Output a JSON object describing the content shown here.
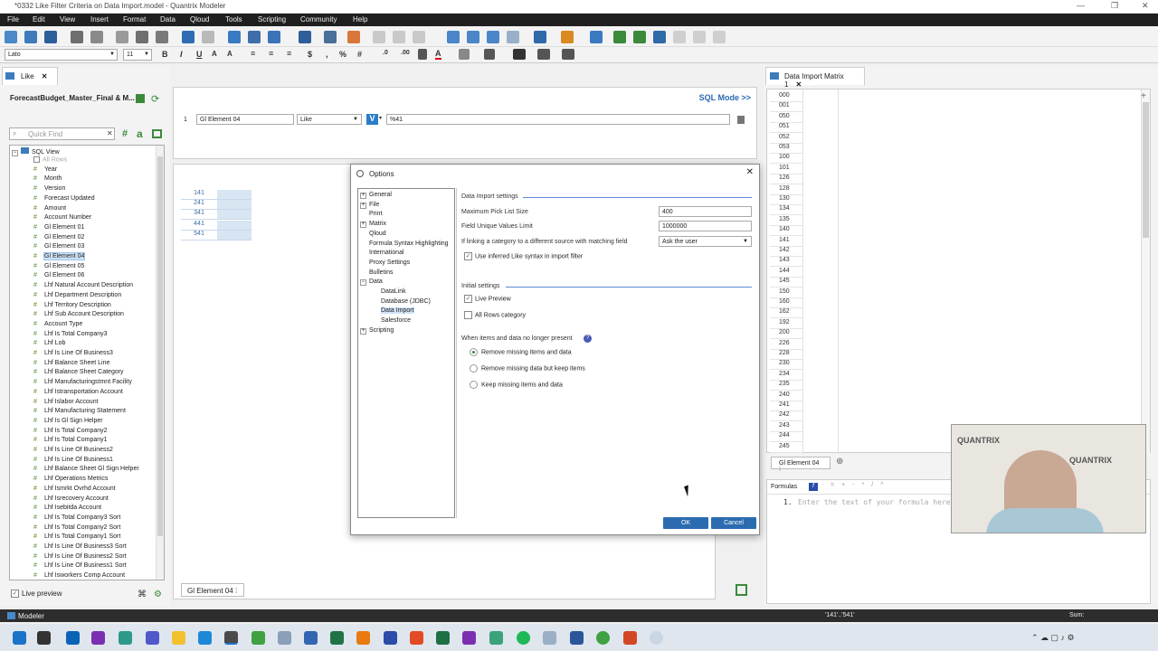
{
  "window": {
    "title": "*0332 Like Filter Criteria on Data Import.model - Quantrix Modeler"
  },
  "menu": [
    "File",
    "Edit",
    "View",
    "Insert",
    "Format",
    "Data",
    "Qloud",
    "Tools",
    "Scripting",
    "Community",
    "Help"
  ],
  "format_bar": {
    "font": "Lato",
    "size": "11"
  },
  "left_tab": {
    "label": "Like",
    "close": "✕"
  },
  "model_name": "ForecastBudget_Master_Final & M...",
  "quick_find": {
    "placeholder": "Quick Find"
  },
  "tree_root": "SQL View",
  "tree_items": [
    {
      "label": "All Rows",
      "kind": "chk"
    },
    {
      "label": "Year",
      "kind": "#"
    },
    {
      "label": "Month",
      "kind": "#"
    },
    {
      "label": "Version",
      "kind": "#"
    },
    {
      "label": "Forecast Updated",
      "kind": "#"
    },
    {
      "label": "Amount",
      "kind": "#"
    },
    {
      "label": "Account Number",
      "kind": "#"
    },
    {
      "label": "Gl Element 01",
      "kind": "#"
    },
    {
      "label": "Gl Element 02",
      "kind": "#"
    },
    {
      "label": "Gl Element 03",
      "kind": "#"
    },
    {
      "label": "Gl Element 04",
      "kind": "#",
      "selected": true
    },
    {
      "label": "Gl Element 05",
      "kind": "#"
    },
    {
      "label": "Gl Element 06",
      "kind": "#"
    },
    {
      "label": "Lhf Natural Account Description",
      "kind": "#"
    },
    {
      "label": "Lhf Department Description",
      "kind": "#"
    },
    {
      "label": "Lhf Territory Description",
      "kind": "#"
    },
    {
      "label": "Lhf Sub Account Description",
      "kind": "#"
    },
    {
      "label": "Account Type",
      "kind": "#"
    },
    {
      "label": "Lhf Is Total Company3",
      "kind": "#"
    },
    {
      "label": "Lhf Lob",
      "kind": "#"
    },
    {
      "label": "Lhf Is Line Of Business3",
      "kind": "#"
    },
    {
      "label": "Lhf Balance Sheet Line",
      "kind": "#"
    },
    {
      "label": "Lhf Balance Sheet Category",
      "kind": "#"
    },
    {
      "label": "Lhf Manufacturingstmnt Facility",
      "kind": "#"
    },
    {
      "label": "Lhf Istransportation Account",
      "kind": "#"
    },
    {
      "label": "Lhf Islabor Account",
      "kind": "#"
    },
    {
      "label": "Lhf Manufacturing Statement",
      "kind": "#"
    },
    {
      "label": "Lhf Is Gl Sign Helper",
      "kind": "#"
    },
    {
      "label": "Lhf Is Total Company2",
      "kind": "#"
    },
    {
      "label": "Lhf Is Total Company1",
      "kind": "#"
    },
    {
      "label": "Lhf Is Line Of Business2",
      "kind": "#"
    },
    {
      "label": "Lhf Is Line Of Business1",
      "kind": "#"
    },
    {
      "label": "Lhf Balance Sheet Gl Sign Helper",
      "kind": "#"
    },
    {
      "label": "Lhf Operations Metrics",
      "kind": "#"
    },
    {
      "label": "Lhf Ismrkt Ovrhd Account",
      "kind": "#"
    },
    {
      "label": "Lhf Isrecovery Account",
      "kind": "#"
    },
    {
      "label": "Lhf Isebitda Account",
      "kind": "#"
    },
    {
      "label": "Lhf Is Total Company3 Sort",
      "kind": "#"
    },
    {
      "label": "Lhf Is Total Company2 Sort",
      "kind": "#"
    },
    {
      "label": "Lhf Is Total Company1 Sort",
      "kind": "#"
    },
    {
      "label": "Lhf Is Line Of Business3 Sort",
      "kind": "#"
    },
    {
      "label": "Lhf Is Line Of Business2 Sort",
      "kind": "#"
    },
    {
      "label": "Lhf Is Line Of Business1 Sort",
      "kind": "#"
    },
    {
      "label": "Lhf Isworkers Comp Account",
      "kind": "#"
    }
  ],
  "live_preview_label": "Live preview",
  "filter": {
    "row": "1",
    "field": "Gl Element 04",
    "operator": "Like",
    "value": "%41",
    "sql_mode": "SQL Mode >>"
  },
  "preview_values": [
    "141",
    "241",
    "341",
    "441",
    "541"
  ],
  "bottom_tab": "Gl Element 04",
  "dialog": {
    "title": "Options",
    "tree": [
      {
        "label": "General",
        "pm": "+"
      },
      {
        "label": "File",
        "pm": "+"
      },
      {
        "label": "Print",
        "pm": ""
      },
      {
        "label": "Matrix",
        "pm": "+"
      },
      {
        "label": "Qloud",
        "pm": ""
      },
      {
        "label": "Formula Syntax Highlighting",
        "pm": ""
      },
      {
        "label": "International",
        "pm": ""
      },
      {
        "label": "Proxy Settings",
        "pm": ""
      },
      {
        "label": "Bulletins",
        "pm": ""
      },
      {
        "label": "Data",
        "pm": "−"
      },
      {
        "label": "DataLink",
        "pm": "child"
      },
      {
        "label": "Database (JDBC)",
        "pm": "child"
      },
      {
        "label": "Data Import",
        "pm": "child",
        "selected": true
      },
      {
        "label": "Salesforce",
        "pm": "child"
      },
      {
        "label": "Scripting",
        "pm": "+"
      }
    ],
    "section1": "Data Import settings",
    "max_pick_label": "Maximum Pick List Size",
    "max_pick_value": "400",
    "field_unique_label": "Field Unique Values Limit",
    "field_unique_value": "1000000",
    "linking_label": "If linking a category to a different source with matching field",
    "linking_value": "Ask the user",
    "use_like_label": "Use inferred Like syntax in import filter",
    "section2": "Initial settings",
    "live_preview": "Live Preview",
    "all_rows": "All Rows category",
    "missing_label": "When items and data no longer present",
    "radio1": "Remove missing items and data",
    "radio2": "Remove missing data but keep items",
    "radio3": "Keep missing items and data",
    "ok": "OK",
    "cancel": "Cancel"
  },
  "right_tab": "Data Import Matrix 1",
  "matrix_rows": [
    "000",
    "001",
    "050",
    "051",
    "052",
    "053",
    "100",
    "101",
    "126",
    "128",
    "130",
    "134",
    "135",
    "140",
    "141",
    "142",
    "143",
    "144",
    "145",
    "150",
    "160",
    "162",
    "192",
    "200",
    "226",
    "228",
    "230",
    "234",
    "235",
    "240",
    "241",
    "242",
    "243",
    "244",
    "245"
  ],
  "matrix_tab": "Gl Element 04",
  "formulas_label": "Formulas",
  "formula_line": "1.",
  "formula_placeholder": "Enter the text of your formula here.",
  "status": {
    "app": "Modeler",
    "selection": "'141'..'541'",
    "sum": "Sum:"
  },
  "webcam": {
    "brand": "QUANTRIX"
  }
}
